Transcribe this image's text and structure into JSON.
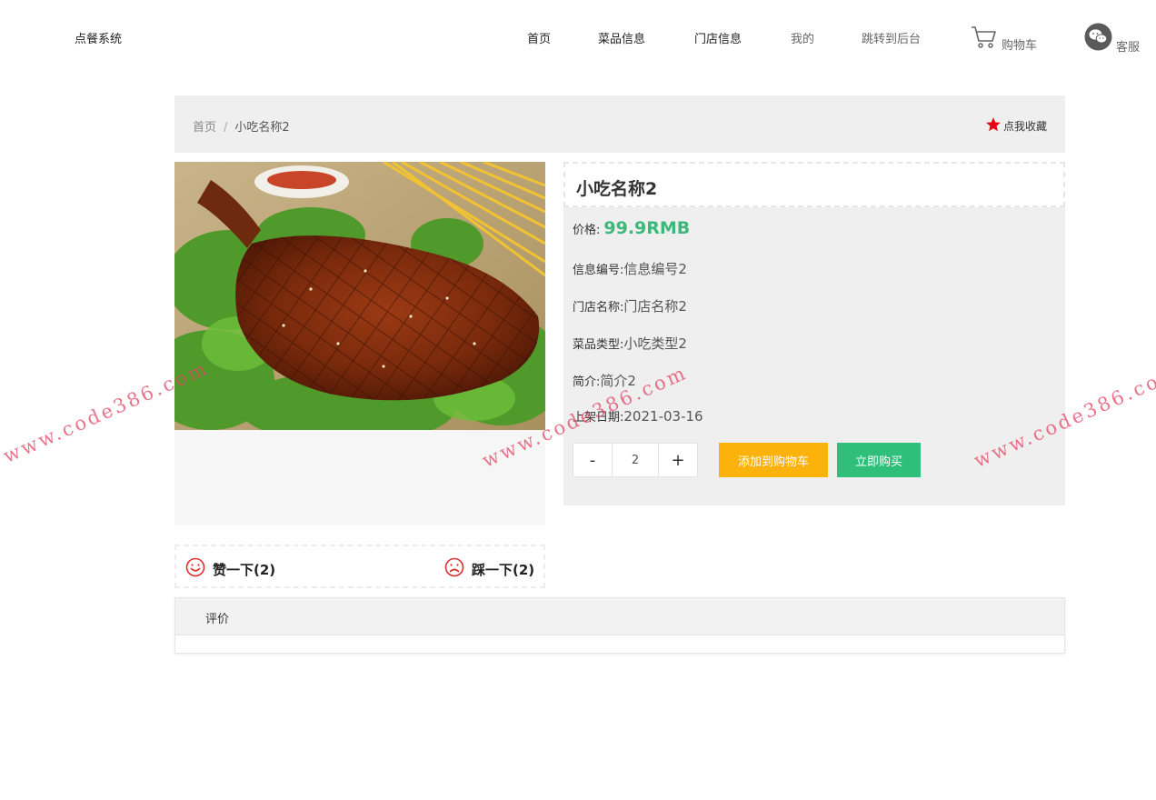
{
  "header": {
    "brand": "点餐系统",
    "nav": [
      {
        "label": "首页"
      },
      {
        "label": "菜品信息"
      },
      {
        "label": "门店信息"
      },
      {
        "label": "我的"
      },
      {
        "label": "跳转到后台"
      }
    ],
    "cart_label": "购物车",
    "service_label": "客服"
  },
  "breadcrumb": {
    "home": "首页",
    "separator": "/",
    "current": "小吃名称2"
  },
  "favorite_label": "点我收藏",
  "product": {
    "title": "小吃名称2",
    "price_label": "价格:",
    "price_value": "99.9RMB",
    "fields": [
      {
        "label": "信息编号:",
        "value": "信息编号2"
      },
      {
        "label": "门店名称:",
        "value": "门店名称2"
      },
      {
        "label": "菜品类型:",
        "value": "小吃类型2"
      },
      {
        "label": "简介:",
        "value": "简介2"
      },
      {
        "label": "上架日期:",
        "value": "2021-03-16"
      }
    ],
    "quantity": "2",
    "minus": "-",
    "plus": "+",
    "add_to_cart": "添加到购物车",
    "buy_now": "立即购买"
  },
  "votes": {
    "like": "赞一下(2)",
    "dislike": "踩一下(2)"
  },
  "review": {
    "tab_label": "评价"
  },
  "watermark": "www.code386.com",
  "colors": {
    "price": "#3bb87a",
    "add_to_cart": "#fbb20a",
    "buy_now": "#2fbf7b",
    "favorite_star": "#e60012",
    "vote_icon": "#d9302c"
  }
}
